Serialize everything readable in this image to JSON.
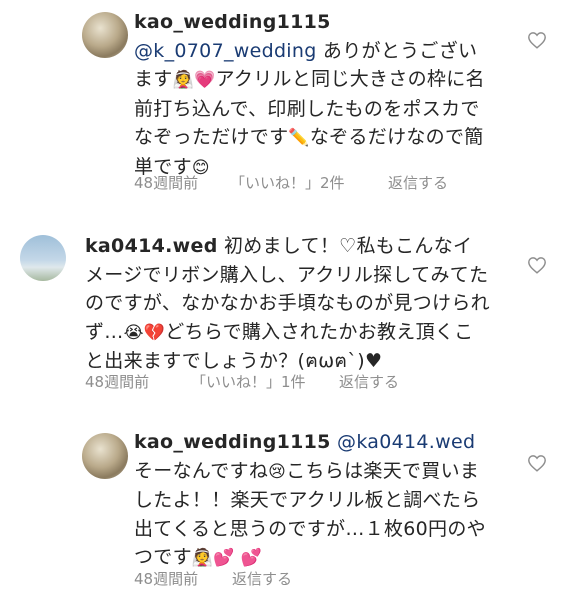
{
  "comments": [
    {
      "username": "kao_wedding1115",
      "mention": "@k_0707_wedding",
      "body_1": " ありがとうございます",
      "emoji_1": "👰💗",
      "body_2": "アクリルと同じ大きさの枠に名前打ち込んで、印刷したものをポスカでなぞっただけです",
      "emoji_2": "✏️",
      "body_3": "なぞるだけなので簡単です",
      "emoji_3": "😊",
      "time": "48週間前",
      "likes": "「いいね！」2件",
      "reply": "返信する"
    },
    {
      "username": "ka0414.wed",
      "body_1": " 初めまして！♡私もこんなイメージでリボン購入し、アクリル探してみてたのですが、なかなかお手頃なものが見つけられず…",
      "emoji_1": "😭💔",
      "body_2": "どちらで購入されたかお教え頂くこと出来ますでしょうか？(ฅωฅ`)♥",
      "time": "48週間前",
      "likes": "「いいね！」1件",
      "reply": "返信する"
    },
    {
      "username": "kao_wedding1115",
      "mention": "@ka0414.wed",
      "body_1": " そーなんですね",
      "emoji_1": "😢",
      "body_2": "こちらは楽天で買いましたよ！！楽天でアクリル板と調べたら出てくると思うのですが…１枚60円のやつです",
      "emoji_2": "👰💕 💕",
      "time": "48週間前",
      "reply": "返信する"
    }
  ],
  "icons": {
    "like": "heart-outline-icon"
  }
}
